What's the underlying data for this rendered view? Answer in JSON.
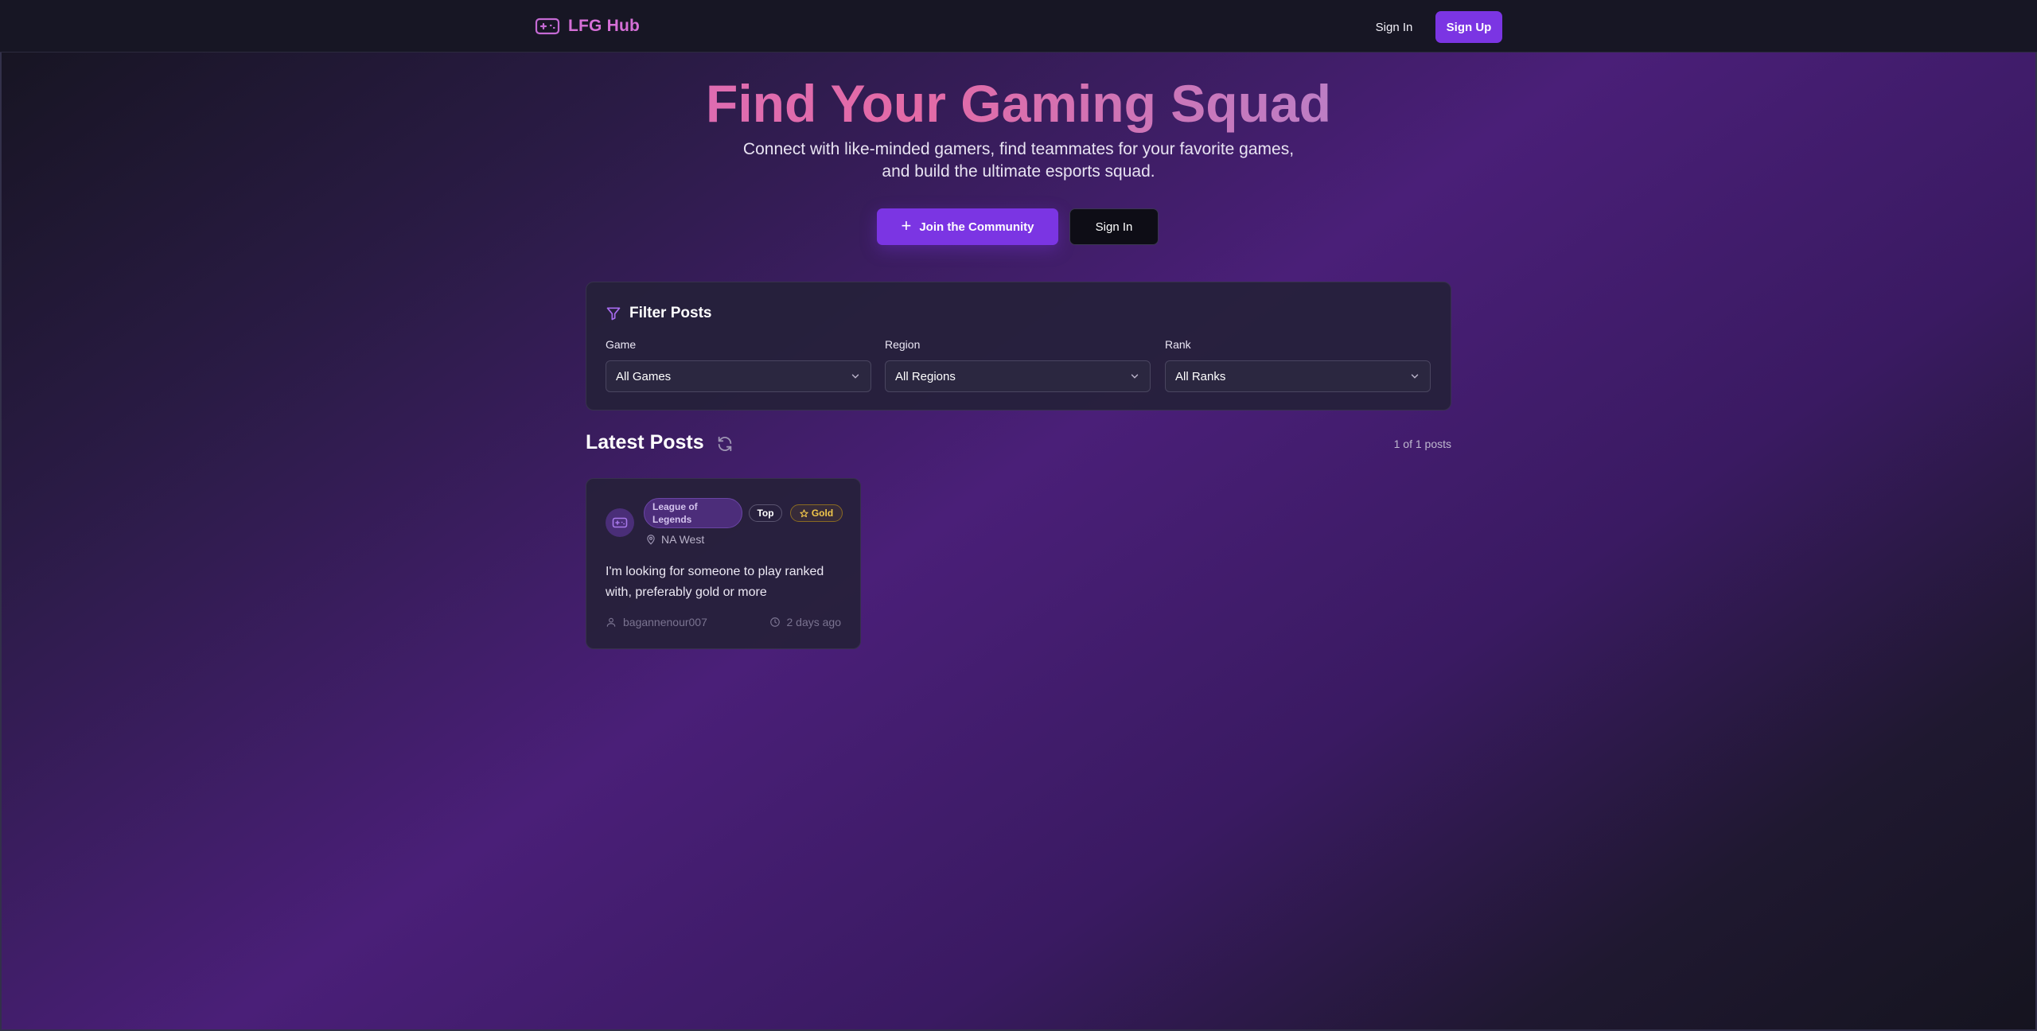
{
  "header": {
    "brand": "LFG Hub",
    "sign_in": "Sign In",
    "sign_up": "Sign Up"
  },
  "hero": {
    "title": "Find Your Gaming Squad",
    "subtitle": "Connect with like-minded gamers, find teammates for your favorite games, and build the ultimate esports squad.",
    "join_button": "Join the Community",
    "sign_in_button": "Sign In"
  },
  "filters": {
    "title": "Filter Posts",
    "game": {
      "label": "Game",
      "value": "All Games"
    },
    "region": {
      "label": "Region",
      "value": "All Regions"
    },
    "rank": {
      "label": "Rank",
      "value": "All Ranks"
    }
  },
  "posts": {
    "title": "Latest Posts",
    "count_text": "1 of 1 posts",
    "items": [
      {
        "game": "League of Legends",
        "role": "Top",
        "rank": "Gold",
        "region": "NA West",
        "body": "I'm looking for someone to play ranked with, preferably gold or more",
        "author": "bagannenour007",
        "time": "2 days ago"
      }
    ]
  },
  "colors": {
    "accent": "#7b35e3",
    "brand": "#d56fd6",
    "rank_gold": "#f2c84b"
  },
  "icons": {
    "brand": "gamepad-icon",
    "filter": "filter-icon",
    "select": "chevron-down-icon",
    "refresh": "refresh-icon",
    "region": "map-pin-icon",
    "author": "user-icon",
    "time": "clock-icon",
    "rank": "star-icon"
  }
}
